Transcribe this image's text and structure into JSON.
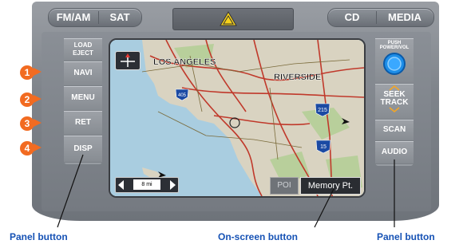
{
  "top_buttons": {
    "fm_am": "FM/AM",
    "sat": "SAT",
    "cd": "CD",
    "media": "MEDIA"
  },
  "left_panel": {
    "load_eject": "LOAD\nEJECT",
    "navi": "NAVI",
    "menu": "MENU",
    "ret": "RET",
    "disp": "DISP"
  },
  "right_panel": {
    "power_vol": "PUSH POWER/VOL",
    "seek_track": "SEEK\nTRACK",
    "scan": "SCAN",
    "audio": "AUDIO"
  },
  "badges": [
    "1",
    "2",
    "3",
    "4"
  ],
  "map": {
    "city1": "LOS ANGELES",
    "city2": "RIVERSIDE",
    "hw1": "405",
    "hw2": "215",
    "hw3": "15",
    "scale": "8 mi",
    "poi_button": "POI",
    "memory_button": "Memory Pt."
  },
  "captions": {
    "left": "Panel button",
    "center": "On-screen button",
    "right": "Panel button"
  },
  "colors": {
    "accent_orange": "#f26b21",
    "caption_blue": "#1652b5",
    "power_ring": "#1e8ee8"
  }
}
